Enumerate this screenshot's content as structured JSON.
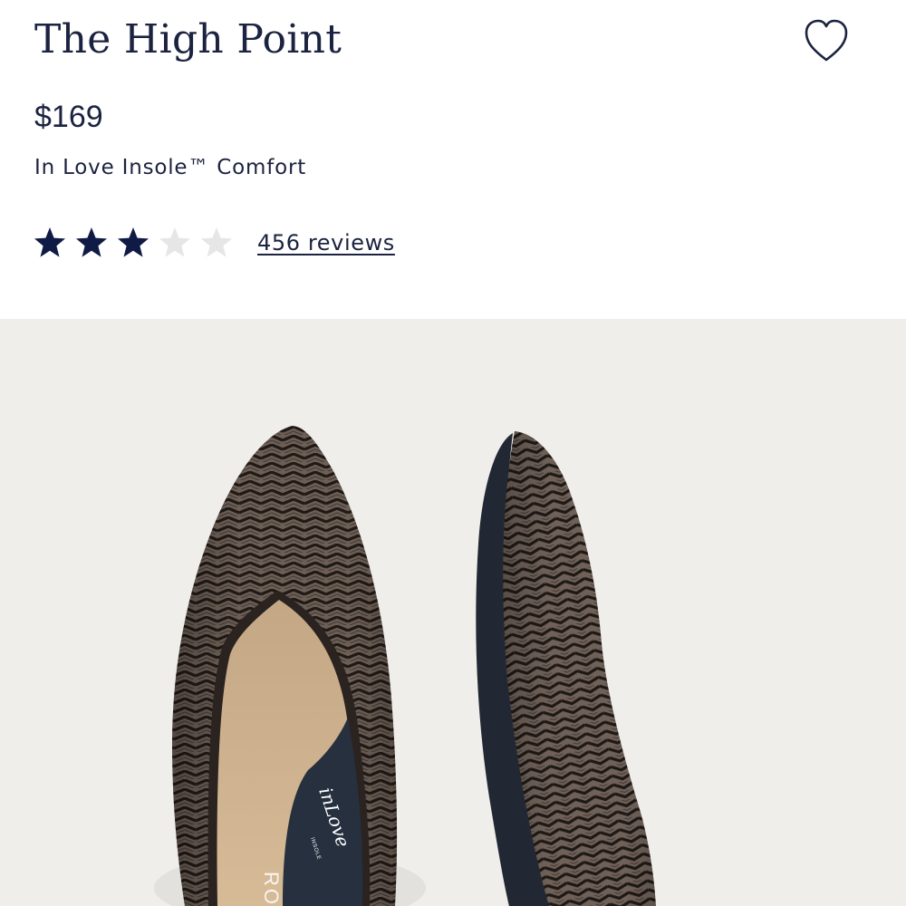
{
  "product": {
    "name": "The High Point",
    "price": "$169",
    "subtitle": "In Love Insole™ Comfort",
    "rating": 3,
    "rating_max": 5,
    "reviews_label": "456 reviews"
  },
  "image": {
    "insole_brand": "inLove",
    "insole_brand_sub": "INSOLE",
    "insole_letters": "RO"
  },
  "icons": {
    "favorite": "heart-outline-icon",
    "star_filled": "star-filled-icon",
    "star_empty": "star-empty-icon"
  },
  "colors": {
    "text_primary": "#1b2340",
    "star_filled": "#101b45",
    "star_empty": "#e6e6e6",
    "image_background": "#f0eeea"
  }
}
